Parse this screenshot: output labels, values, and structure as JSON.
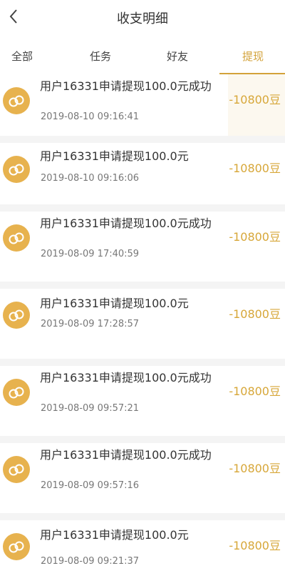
{
  "header": {
    "title": "收支明细"
  },
  "tabs": [
    {
      "label": "全部",
      "active": false
    },
    {
      "label": "任务",
      "active": false
    },
    {
      "label": "好友",
      "active": false
    },
    {
      "label": "提现",
      "active": true
    }
  ],
  "records": [
    {
      "desc": "用户16331申请提现100.0元成功",
      "time": "2019-08-10 09:16:41",
      "amount": "-10800豆"
    },
    {
      "desc": "用户16331申请提现100.0元",
      "time": "2019-08-10 09:16:06",
      "amount": "-10800豆"
    },
    {
      "desc": "用户16331申请提现100.0元成功",
      "time": "2019-08-09 17:40:59",
      "amount": "-10800豆"
    },
    {
      "desc": "用户16331申请提现100.0元",
      "time": "2019-08-09 17:28:57",
      "amount": "-10800豆"
    },
    {
      "desc": "用户16331申请提现100.0元成功",
      "time": "2019-08-09 09:57:21",
      "amount": "-10800豆"
    },
    {
      "desc": "用户16331申请提现100.0元成功",
      "time": "2019-08-09 09:57:16",
      "amount": "-10800豆"
    },
    {
      "desc": "用户16331申请提现100.0元",
      "time": "2019-08-09 09:21:37",
      "amount": "-10800豆"
    }
  ],
  "icons": {
    "back": "back-arrow-icon",
    "coin": "coin-icon"
  },
  "colors": {
    "accent": "#d7a739",
    "coin": "#e7b24e",
    "divider": "#f4f4f4"
  }
}
